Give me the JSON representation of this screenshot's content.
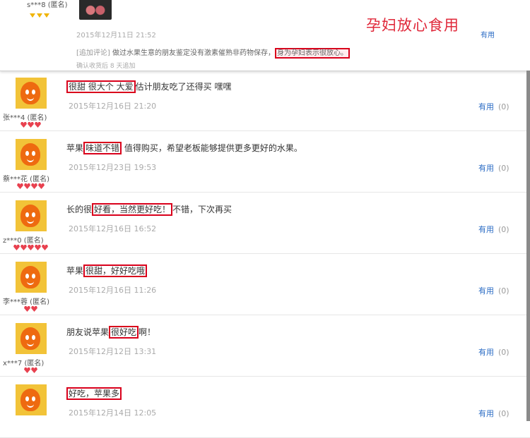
{
  "top": {
    "user": "s***8 (匿名)",
    "date": "2015年12月11日 21:52",
    "banner": "孕妇放心食用",
    "useful_label": "有用",
    "append_tag": "[追加评论]",
    "append_text": "做过水果生意的朋友鉴定没有激素催熟非药物保存，",
    "append_highlight": "身为孕妇表示很放心。",
    "append_note": "确认收货后 8 天追加"
  },
  "reviews": [
    {
      "user": "张***4 (匿名)",
      "hearts": 3,
      "hi": "很甜 很大个 大爱",
      "rest": "估计朋友吃了还得买 嘿嘿",
      "date": "2015年12月16日 21:20",
      "useful": "有用",
      "count": "(0)"
    },
    {
      "user": "蔡***花 (匿名)",
      "hearts": 4,
      "pre": "苹果",
      "hi": "味道不错",
      "rest": "  值得购买，希望老板能够提供更多更好的水果。",
      "date": "2015年12月23日 19:53",
      "useful": "有用",
      "count": "(0)"
    },
    {
      "user": "z***0 (匿名)",
      "hearts": 5,
      "pre": "长的很",
      "hi": "好看，当然更好吃！",
      "rest": "不错，下次再买",
      "date": "2015年12月16日 16:52",
      "useful": "有用",
      "count": "(0)"
    },
    {
      "user": "李***蓉 (匿名)",
      "hearts": 2,
      "pre": "苹果",
      "hi": "很甜，好好吃哦",
      "rest": "",
      "date": "2015年12月16日 11:26",
      "useful": "有用",
      "count": "(0)"
    },
    {
      "user": "x***7 (匿名)",
      "hearts": 2,
      "pre": "朋友说苹果",
      "hi": "很好吃",
      "rest": "啊！",
      "date": "2015年12月12日 13:31",
      "useful": "有用",
      "count": "(0)"
    },
    {
      "user": "",
      "hearts": 0,
      "pre": "",
      "hi": "好吃，苹果多",
      "rest": "",
      "date": "2015年12月14日 12:05",
      "useful": "有用",
      "count": "(0)"
    }
  ]
}
